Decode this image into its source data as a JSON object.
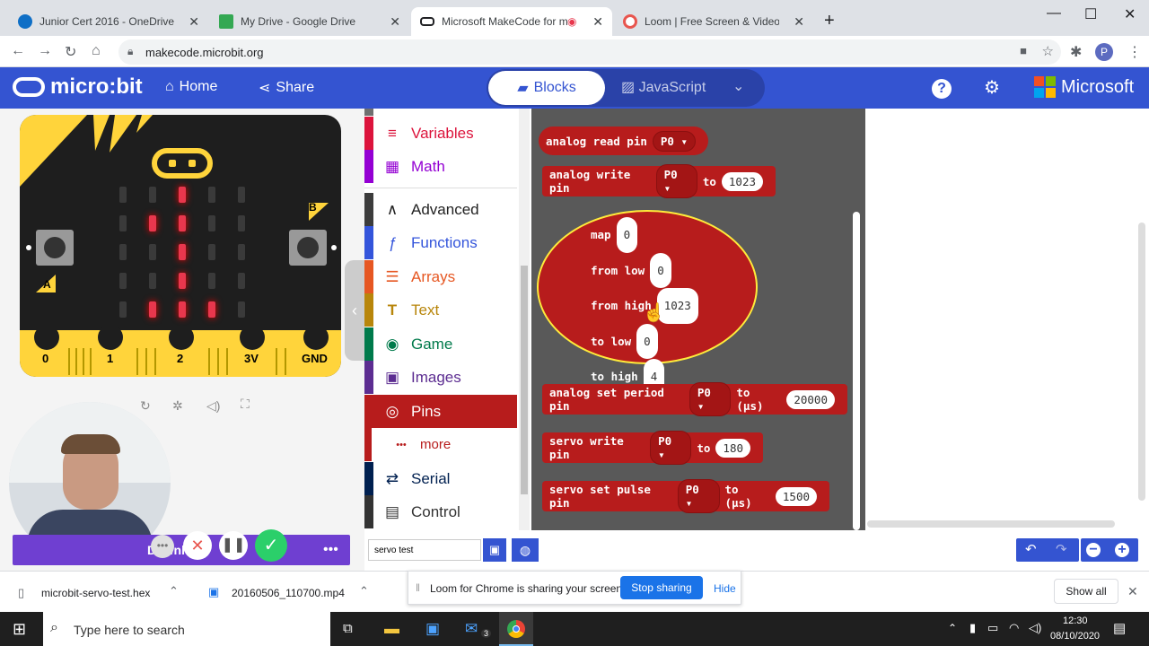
{
  "browser": {
    "tabs": [
      {
        "title": "Junior Cert 2016 - OneDrive",
        "color": "#0f6fc6"
      },
      {
        "title": "My Drive - Google Drive",
        "color": "#34a853"
      },
      {
        "title": "Microsoft MakeCode for mic",
        "color": "#202124"
      },
      {
        "title": "Loom | Free Screen & Video Rec",
        "color": "#e8554e"
      }
    ],
    "url": "makecode.microbit.org",
    "profile_initial": "P"
  },
  "header": {
    "logo": "micro:bit",
    "home": "Home",
    "share": "Share",
    "blocks": "Blocks",
    "javascript": "JavaScript",
    "brand": "Microsoft"
  },
  "simulator": {
    "btn_a": "A",
    "btn_b": "B",
    "pins": [
      "0",
      "1",
      "2",
      "3V",
      "GND"
    ]
  },
  "toolbox": {
    "categories": [
      {
        "label": "Variables",
        "color": "#dc143c",
        "icon": "≡"
      },
      {
        "label": "Math",
        "color": "#9400d3",
        "icon": "▦"
      },
      {
        "label": "Advanced",
        "color": "#3c3c3c",
        "icon": "∧"
      },
      {
        "label": "Functions",
        "color": "#3455db",
        "icon": "ƒ"
      },
      {
        "label": "Arrays",
        "color": "#e65722",
        "icon": "☰"
      },
      {
        "label": "Text",
        "color": "#b8860b",
        "icon": "T"
      },
      {
        "label": "Game",
        "color": "#007a4b",
        "icon": "◉"
      },
      {
        "label": "Images",
        "color": "#5c2d91",
        "icon": "▣"
      },
      {
        "label": "Pins",
        "color": "#b71c1c",
        "icon": "◎"
      },
      {
        "label": "more",
        "color": "#b71c1c",
        "icon": "•••"
      },
      {
        "label": "Serial",
        "color": "#002050",
        "icon": "⇄"
      },
      {
        "label": "Control",
        "color": "#333333",
        "icon": "▤"
      }
    ]
  },
  "blocks": {
    "analog_read": {
      "text": "analog read pin",
      "pin": "P0"
    },
    "analog_write": {
      "text": "analog write pin",
      "pin": "P0",
      "to": "to",
      "value": "1023"
    },
    "map": {
      "map": "map",
      "map_val": "0",
      "from_low": "from low",
      "from_low_val": "0",
      "from_high": "from high",
      "from_high_val": "1023",
      "to_low": "to low",
      "to_low_val": "0",
      "to_high": "to high",
      "to_high_val": "4"
    },
    "set_period": {
      "text": "analog set period pin",
      "pin": "P0",
      "to": "to (µs)",
      "value": "20000"
    },
    "servo_write": {
      "text": "servo write pin",
      "pin": "P0",
      "to": "to",
      "value": "180"
    },
    "servo_pulse": {
      "text": "servo set pulse pin",
      "pin": "P0",
      "to": "to (µs)",
      "value": "1500"
    }
  },
  "bottom": {
    "project_name": "servo test",
    "download_label": "Download"
  },
  "downloads": {
    "file1": "microbit-servo-test.hex",
    "file2": "20160506_110700.mp4",
    "show_all": "Show all"
  },
  "loom_banner": {
    "text": "Loom for Chrome is sharing your screen.",
    "stop": "Stop sharing",
    "hide": "Hide"
  },
  "taskbar": {
    "search": "Type here to search",
    "time": "12:30",
    "date": "08/10/2020",
    "mail_badge": "3"
  }
}
